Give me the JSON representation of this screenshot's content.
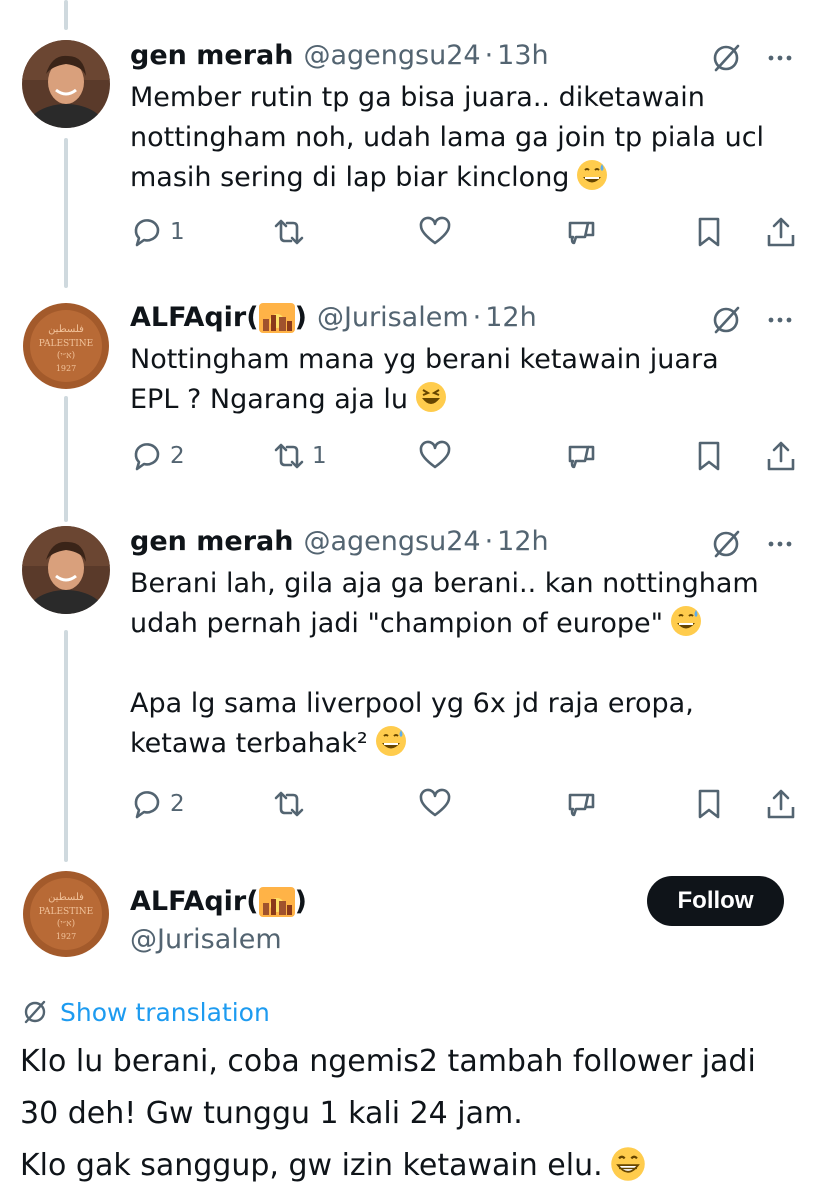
{
  "tweets": [
    {
      "name": "gen merah",
      "handle": "@agengsu24",
      "dot": "·",
      "time": "13h",
      "lines": [
        "Member rutin tp ga bisa juara.. diketawain",
        "nottingham noh, udah lama ga join tp piala ucl",
        "masih sering di lap biar kinclong"
      ],
      "reply_count": "1",
      "retweet_count": "",
      "like_count": ""
    },
    {
      "name": "ALFAqir(",
      "name_close": ")",
      "handle": "@Jurisalem",
      "dot": "·",
      "time": "12h",
      "lines": [
        "Nottingham mana yg berani ketawain juara",
        "EPL ? Ngarang aja lu"
      ],
      "reply_count": "2",
      "retweet_count": "1",
      "like_count": ""
    },
    {
      "name": "gen merah",
      "handle": "@agengsu24",
      "dot": "·",
      "time": "12h",
      "lines": [
        "Berani lah, gila aja ga berani.. kan nottingham",
        "udah pernah jadi \"champion of europe\"",
        "Apa lg sama liverpool yg 6x jd raja eropa,",
        "ketawa terbahak²"
      ],
      "reply_count": "2",
      "retweet_count": "",
      "like_count": ""
    }
  ],
  "main_tweet": {
    "name": "ALFAqir(",
    "name_close": ")",
    "handle": "@Jurisalem",
    "follow_label": "Follow",
    "translate_label": "Show translation",
    "lines": [
      "Klo lu berani, coba ngemis2 tambah follower jadi",
      "30 deh! Gw tunggu 1 kali 24 jam.",
      "Klo gak sanggup, gw izin ketawain elu."
    ]
  },
  "icons": {
    "reply": "reply-icon",
    "retweet": "retweet-icon",
    "like": "heart-icon",
    "grok": "grok-icon",
    "bookmark": "bookmark-icon",
    "share": "share-icon",
    "more": "more-icon"
  },
  "colors": {
    "text": "#0f1419",
    "secondary": "#536471",
    "link": "#1d9bf0",
    "thread_line": "#cfd9de",
    "follow_bg": "#0f1419"
  }
}
